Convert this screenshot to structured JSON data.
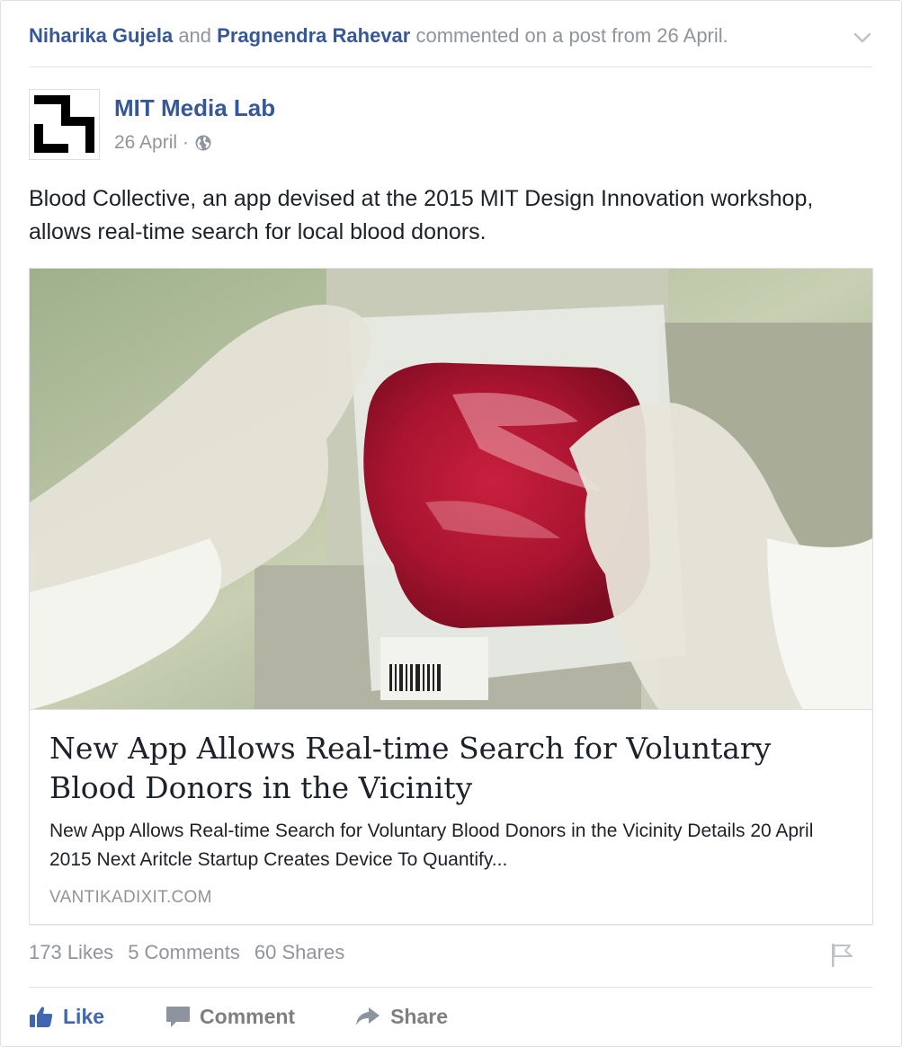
{
  "story": {
    "actor_1": "Niharika Gujela",
    "connector": "and",
    "actor_2": "Pragnendra Rahevar",
    "action_text": "commented on a post from 26 April."
  },
  "author": {
    "name": "MIT Media Lab",
    "date": "26 April",
    "separator": "·",
    "privacy_icon": "globe-icon"
  },
  "post": {
    "message": "Blood Collective, an app devised at the 2015 MIT Design Innovation workshop, allows real-time search for local blood donors."
  },
  "link_preview": {
    "title": "New App Allows Real-time Search for Voluntary Blood Donors in the Vicinity",
    "description": "New App Allows Real-time Search for Voluntary Blood Donors in the Vicinity Details 20 April 2015 Next Aritcle Startup Creates Device To Quantify...",
    "domain": "VANTIKADIXIT.COM"
  },
  "stats": {
    "likes": "173 Likes",
    "comments": "5 Comments",
    "shares": "60 Shares"
  },
  "actions": {
    "like": "Like",
    "comment": "Comment",
    "share": "Share"
  },
  "colors": {
    "link_blue": "#365899",
    "like_blue": "#4267b2",
    "meta_gray": "#90949c",
    "text": "#1d2129"
  }
}
